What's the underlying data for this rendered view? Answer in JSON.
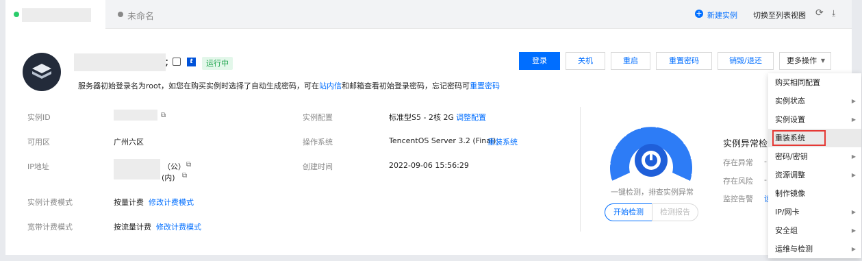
{
  "tabs": [
    {
      "label": "",
      "active": true,
      "status_color": "#29cc6a"
    },
    {
      "label": "未命名",
      "active": false,
      "status_color": "#888888"
    }
  ],
  "toolbar": {
    "new_instance": "新建实例",
    "switch_list": "切换至列表视图"
  },
  "instance": {
    "status": "运行中",
    "tip_part1": "服务器初始登录名为root，如您在购买实例时选择了自动生成密码，可在",
    "tip_link1": "站内信",
    "tip_part2": "和邮箱查看初始登录密码，忘记密码可",
    "tip_link2": "重置密码"
  },
  "actions": {
    "login": "登录",
    "shutdown": "关机",
    "restart": "重启",
    "reset_password": "重置密码",
    "destroy": "销毁/退还",
    "more": "更多操作"
  },
  "details": {
    "id_label": "实例ID",
    "zone_label": "可用区",
    "zone_value": "广州六区",
    "ip_label": "IP地址",
    "ip_public": "（公）",
    "ip_private": "(内)",
    "billing_label": "实例计费模式",
    "billing_value": "按量计费",
    "billing_link": "修改计费模式",
    "bw_label": "宽带计费模式",
    "bw_value": "按流量计费",
    "bw_link": "修改计费模式",
    "config_label": "实例配置",
    "config_value": "标准型S5 - 2核 2G",
    "config_link": "调整配置",
    "os_label": "操作系统",
    "os_value": "TencentOS Server 3.2 (Final)",
    "os_link": "重装系统",
    "created_label": "创建时间",
    "created_value": "2022-09-06 15:56:29"
  },
  "check": {
    "caption": "一键检测，排查实例异常",
    "start": "开始检测",
    "report": "检测报告",
    "title": "实例异常检测",
    "row1": "存在异常",
    "row2": "存在风险",
    "row3": "监控告警",
    "row1_value": "-",
    "row2_value": "-",
    "row3_value": "设"
  },
  "menu": [
    {
      "label": "购买相同配置",
      "sub": false
    },
    {
      "label": "实例状态",
      "sub": true
    },
    {
      "label": "实例设置",
      "sub": true
    },
    {
      "label": "重装系统",
      "sub": false,
      "highlight": true
    },
    {
      "label": "密码/密钥",
      "sub": true
    },
    {
      "label": "资源调整",
      "sub": true
    },
    {
      "label": "制作镜像",
      "sub": false
    },
    {
      "label": "IP/网卡",
      "sub": true
    },
    {
      "label": "安全组",
      "sub": true
    },
    {
      "label": "运维与检测",
      "sub": true
    }
  ],
  "colors": {
    "accent": "#006eff",
    "running": "#29cc6a",
    "highlight_border": "#e53935"
  },
  "icons": {
    "edit": "edit-icon",
    "tag": "tag-icon",
    "copy": "copy-icon",
    "refresh": "refresh-icon",
    "download": "download-icon",
    "add": "add-circle-icon"
  }
}
